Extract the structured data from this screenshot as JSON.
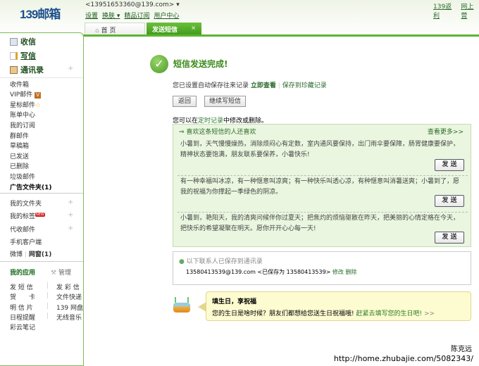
{
  "header": {
    "logo": "139邮箱",
    "email": "<13951653360@139.com> ▾",
    "links": [
      "设置",
      "换肤 ▾",
      "精品订阅",
      "用户中心"
    ],
    "right_links": [
      "139返利",
      "网上营"
    ]
  },
  "tabs": [
    {
      "label": "首 页"
    },
    {
      "label": "发送短信",
      "close": "×"
    }
  ],
  "sidebar": {
    "main": [
      "收信",
      "写信",
      "通讯录"
    ],
    "folders": [
      "收件箱",
      "VIP邮件",
      "星标邮件",
      "账单中心",
      "我的订阅",
      "群邮件",
      "草稿箱",
      "已发送",
      "已删除",
      "垃圾邮件",
      "广告文件夹(1)"
    ],
    "extra": [
      "我的文件夹",
      "我的标签",
      "代收邮件",
      "手机客户端"
    ],
    "new_badge": "NEW",
    "weibo": "微博",
    "weibo_sep": "|",
    "lattice": "网窗(1)",
    "apps_title": "我的应用",
    "manage": "管理",
    "apps": [
      [
        "发 短 信",
        "发 彩 信"
      ],
      [
        "贺　　卡",
        "文件快递"
      ],
      [
        "明 信 片",
        "139 网盘"
      ],
      [
        "日程提醒",
        "无线音乐"
      ],
      [
        "彩云笔记",
        ""
      ]
    ]
  },
  "main": {
    "title": "短信发送完成!",
    "autosave_text": "您已设置自动保存往来记录",
    "view_now": "立即查看",
    "save_treasure": "保存到珍藏记录",
    "back": "返回",
    "continue": "继续写短信",
    "hint_pre": "您可以在",
    "hint_link": "定时记录",
    "hint_post": "中修改或删除。",
    "rec_title": "⇒ 喜欢这条短信的人还喜欢",
    "rec_more": "查看更多>>",
    "messages": [
      "小暑到，天气慢慢燥热，消除烦闷心有定数，室内通风要保持，出门雨伞要保障，肠胃健康要保护，精神状态要饱满，朋友联系要保养，小暑快乐!",
      "有一种幸福叫冰凉，有一种惬意叫凉爽；有一种快乐叫透心凉，有种惬意叫消暑送爽；小暑到了，愿我的祝福为你撑起一季绿色的阴凉。",
      "小暑到，艳阳天，我的清爽问候伴你过夏天；把焦灼的烦恼驱散在昨天，把美丽的心情定格在今天，把快乐的希望凝聚在明天。愿你开开心心每一天!"
    ],
    "send": "发 送",
    "saved_title": "以下联系人已保存到通讯录",
    "saved_contact": "13580413539@139.com <已保存为 13580413539>",
    "edit": "修改",
    "delete": "删除",
    "bday_title": "填生日，享祝福",
    "bday_text": "您的生日是啥时候？朋友们都想给您送生日祝福哦!",
    "bday_link": "赶紧去填写您的生日吧!",
    "bday_arrow": ">>"
  },
  "footer": {
    "name": "陈克远",
    "url": "http://home.zhubajie.com/5082343/"
  }
}
